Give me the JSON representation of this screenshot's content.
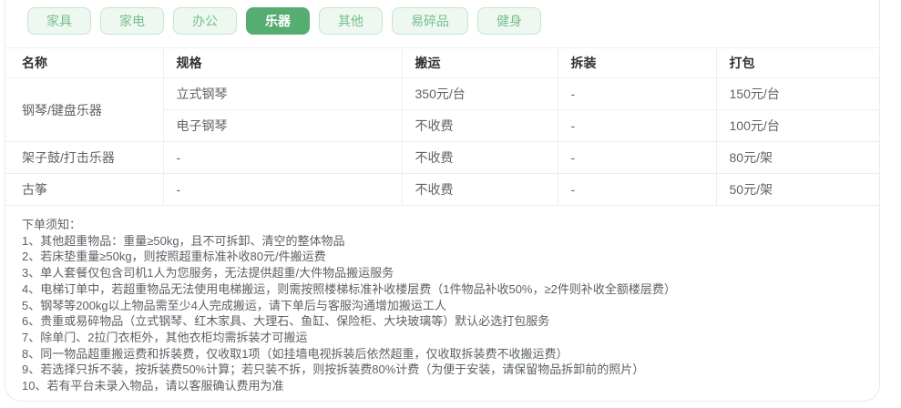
{
  "tabs": [
    {
      "label": "家具",
      "active": false
    },
    {
      "label": "家电",
      "active": false
    },
    {
      "label": "办公",
      "active": false
    },
    {
      "label": "乐器",
      "active": true
    },
    {
      "label": "其他",
      "active": false
    },
    {
      "label": "易碎品",
      "active": false
    },
    {
      "label": "健身",
      "active": false
    }
  ],
  "table": {
    "columns": [
      "名称",
      "规格",
      "搬运",
      "拆装",
      "打包"
    ],
    "rows": [
      {
        "name": "钢琴/键盘乐器",
        "spec": "立式钢琴",
        "move": "350元/台",
        "disassemble": "-",
        "pack": "150元/台"
      },
      {
        "spec": "电子钢琴",
        "move": "不收费",
        "disassemble": "-",
        "pack": "100元/台"
      },
      {
        "name": "架子鼓/打击乐器",
        "spec": "-",
        "move": "不收费",
        "disassemble": "-",
        "pack": "80元/架"
      },
      {
        "name": "古筝",
        "spec": "-",
        "move": "不收费",
        "disassemble": "-",
        "pack": "50元/架"
      }
    ]
  },
  "notes": {
    "title": "下单须知：",
    "items": [
      "1、其他超重物品：重量≥50kg，且不可拆卸、清空的整体物品",
      "2、若床垫重量≥50kg，则按照超重标准补收80元/件搬运费",
      "3、单人套餐仅包含司机1人为您服务，无法提供超重/大件物品搬运服务",
      "4、电梯订单中，若超重物品无法使用电梯搬运，则需按照楼梯标准补收楼层费（1件物品补收50%，≥2件则补收全额楼层费）",
      "5、钢琴等200kg以上物品需至少4人完成搬运，请下单后与客服沟通增加搬运工人",
      "6、贵重或易碎物品（立式钢琴、红木家具、大理石、鱼缸、保险柜、大块玻璃等）默认必选打包服务",
      "7、除单门、2拉门衣柜外，其他衣柜均需拆装才可搬运",
      "8、同一物品超重搬运费和拆装费，仅收取1项（如挂墙电视拆装后依然超重，仅收取拆装费不收搬运费）",
      "9、若选择只拆不装，按拆装费50%计算；若只装不拆，则按拆装费80%计费（为便于安装，请保留物品拆卸前的照片）",
      "10、若有平台未录入物品，请以客服确认费用为准"
    ]
  },
  "colors": {
    "accent_green": "#55ad72",
    "tab_inactive_bg": "#eef8f1",
    "tab_inactive_border": "#c5e5ce",
    "tab_inactive_text": "#77be8c",
    "table_border": "#ebeef5",
    "card_border": "#e4eeeb",
    "header_text": "#303133",
    "cell_text": "#606266",
    "notes_text": "#5c6166"
  }
}
